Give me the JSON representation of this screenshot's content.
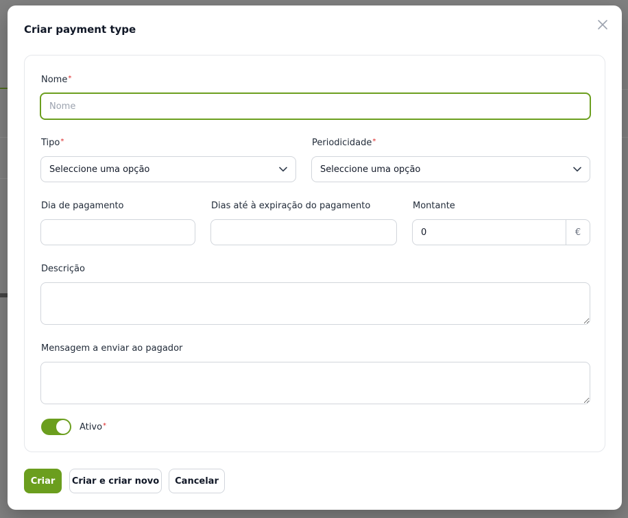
{
  "modal": {
    "title": "Criar payment type",
    "close_icon": "close-icon"
  },
  "form": {
    "nome": {
      "label": "Nome",
      "required_mark": "*",
      "placeholder": "Nome",
      "value": ""
    },
    "tipo": {
      "label": "Tipo",
      "required_mark": "*",
      "selected": "Seleccione uma opção"
    },
    "periodicidade": {
      "label": "Periodicidade",
      "required_mark": "*",
      "selected": "Seleccione uma opção"
    },
    "dia_pagamento": {
      "label": "Dia de pagamento",
      "value": ""
    },
    "dias_expiracao": {
      "label": "Dias até à expiração do pagamento",
      "value": ""
    },
    "montante": {
      "label": "Montante",
      "value": "0",
      "currency": "€"
    },
    "descricao": {
      "label": "Descrição",
      "value": ""
    },
    "mensagem": {
      "label": "Mensagem a enviar ao pagador",
      "value": ""
    },
    "ativo": {
      "label": "Ativo",
      "required_mark": "*",
      "on": true
    }
  },
  "actions": {
    "create": "Criar",
    "create_another": "Criar e criar novo",
    "cancel": "Cancelar"
  },
  "colors": {
    "accent": "#6b9e1e",
    "required": "#dc2626",
    "border": "#d1d5db"
  }
}
